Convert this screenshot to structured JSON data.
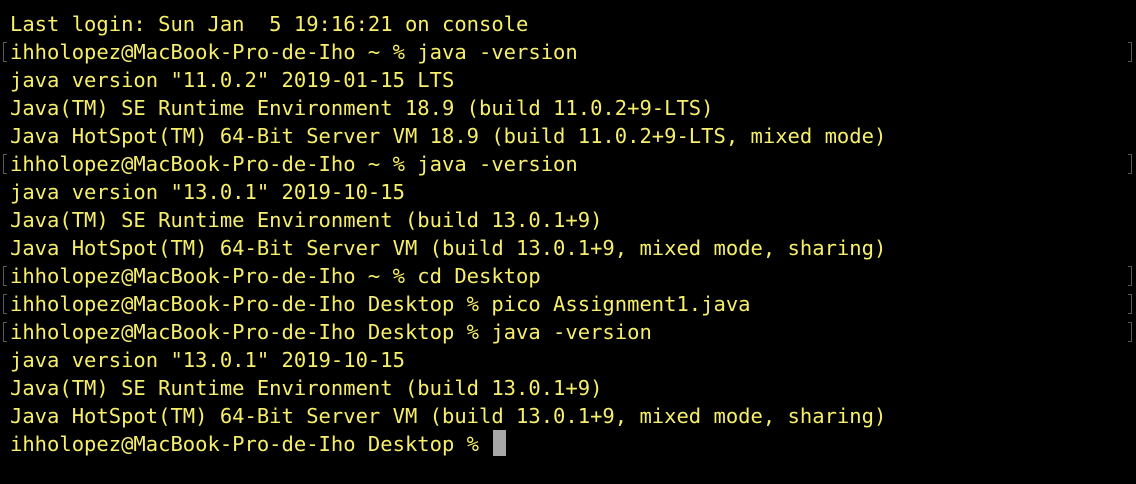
{
  "terminal": {
    "colors": {
      "background": "#000000",
      "text": "#f7ef6b",
      "cursor": "#a7a7a7",
      "marks": "#5a5a5a"
    },
    "lines": [
      "Last login: Sun Jan  5 19:16:21 on console",
      "ihholopez@MacBook-Pro-de-Iho ~ % java -version",
      "java version \"11.0.2\" 2019-01-15 LTS",
      "Java(TM) SE Runtime Environment 18.9 (build 11.0.2+9-LTS)",
      "Java HotSpot(TM) 64-Bit Server VM 18.9 (build 11.0.2+9-LTS, mixed mode)",
      "ihholopez@MacBook-Pro-de-Iho ~ % java -version",
      "java version \"13.0.1\" 2019-10-15",
      "Java(TM) SE Runtime Environment (build 13.0.1+9)",
      "Java HotSpot(TM) 64-Bit Server VM (build 13.0.1+9, mixed mode, sharing)",
      "ihholopez@MacBook-Pro-de-Iho ~ % cd Desktop",
      "ihholopez@MacBook-Pro-de-Iho Desktop % pico Assignment1.java",
      "ihholopez@MacBook-Pro-de-Iho Desktop % java -version",
      "java version \"13.0.1\" 2019-10-15",
      "Java(TM) SE Runtime Environment (build 13.0.1+9)",
      "Java HotSpot(TM) 64-Bit Server VM (build 13.0.1+9, mixed mode, sharing)",
      "ihholopez@MacBook-Pro-de-Iho Desktop % "
    ]
  }
}
